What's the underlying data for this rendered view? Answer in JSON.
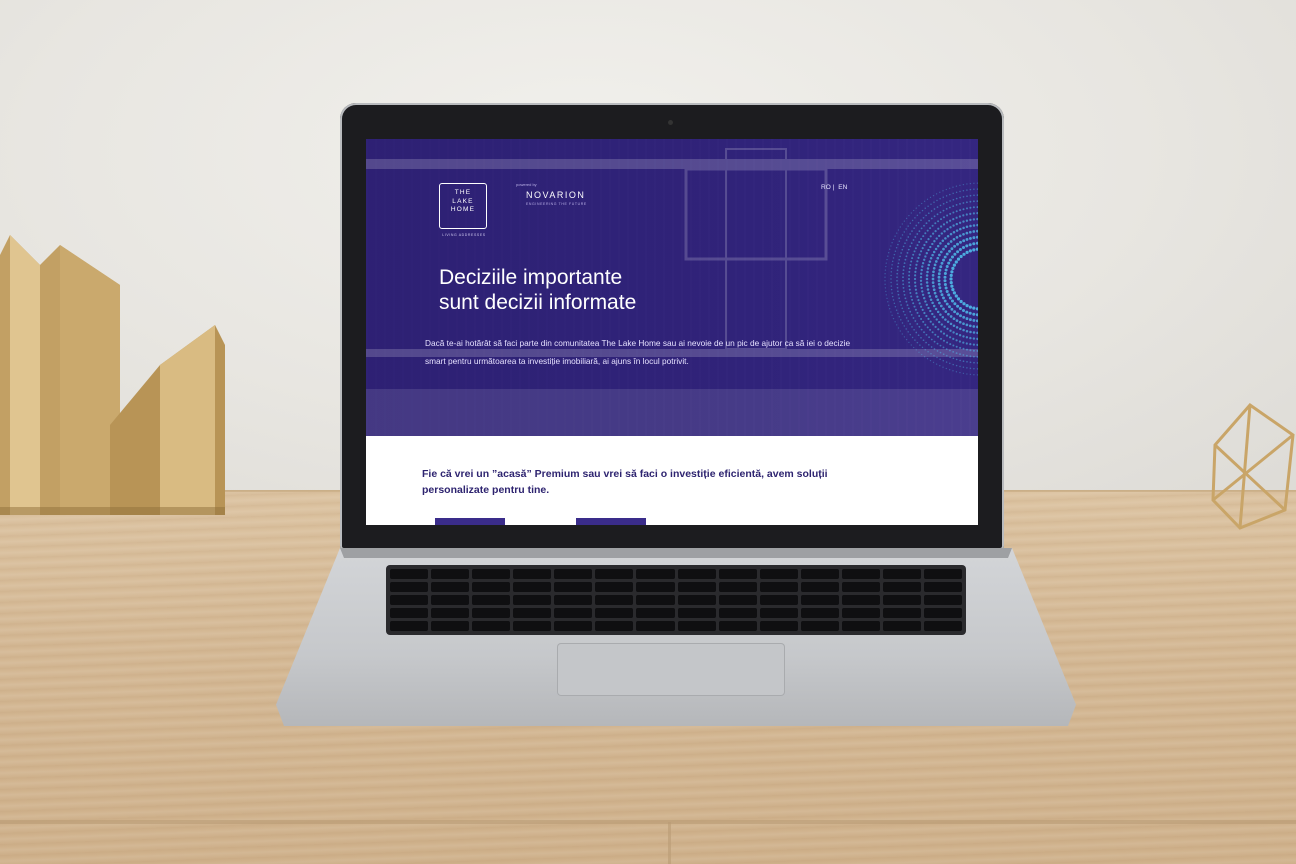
{
  "site": {
    "logo": {
      "lines": [
        "THE",
        "LAKE",
        "HOME"
      ],
      "tagline": "LIVING ADDRESSES"
    },
    "partner": {
      "powered_by": "powered by",
      "name": "NOVARION",
      "tagline": "ENGINEERING THE FUTURE"
    },
    "language": {
      "options": [
        "RO",
        "EN"
      ],
      "separator": "|"
    },
    "hero": {
      "headline_line1": "Deciziile importante",
      "headline_line2": "sunt decizii informate",
      "intro": "Dacă te-ai hotărât să faci parte din comunitatea The Lake Home sau ai nevoie de un pic de ajutor ca să iei o decizie smart pentru următoarea ta investiție imobiliară, ai ajuns în locul potrivit."
    },
    "section": {
      "text": "Fie că vrei un ”acasă” Premium sau vrei să faci o investiție eficientă, avem soluții personalizate pentru tine."
    }
  },
  "colors": {
    "hero_bg": "#2f2278",
    "accent_dots": "#4fb6e6",
    "section_text": "#2e2470",
    "button": "#3a2c8a"
  }
}
